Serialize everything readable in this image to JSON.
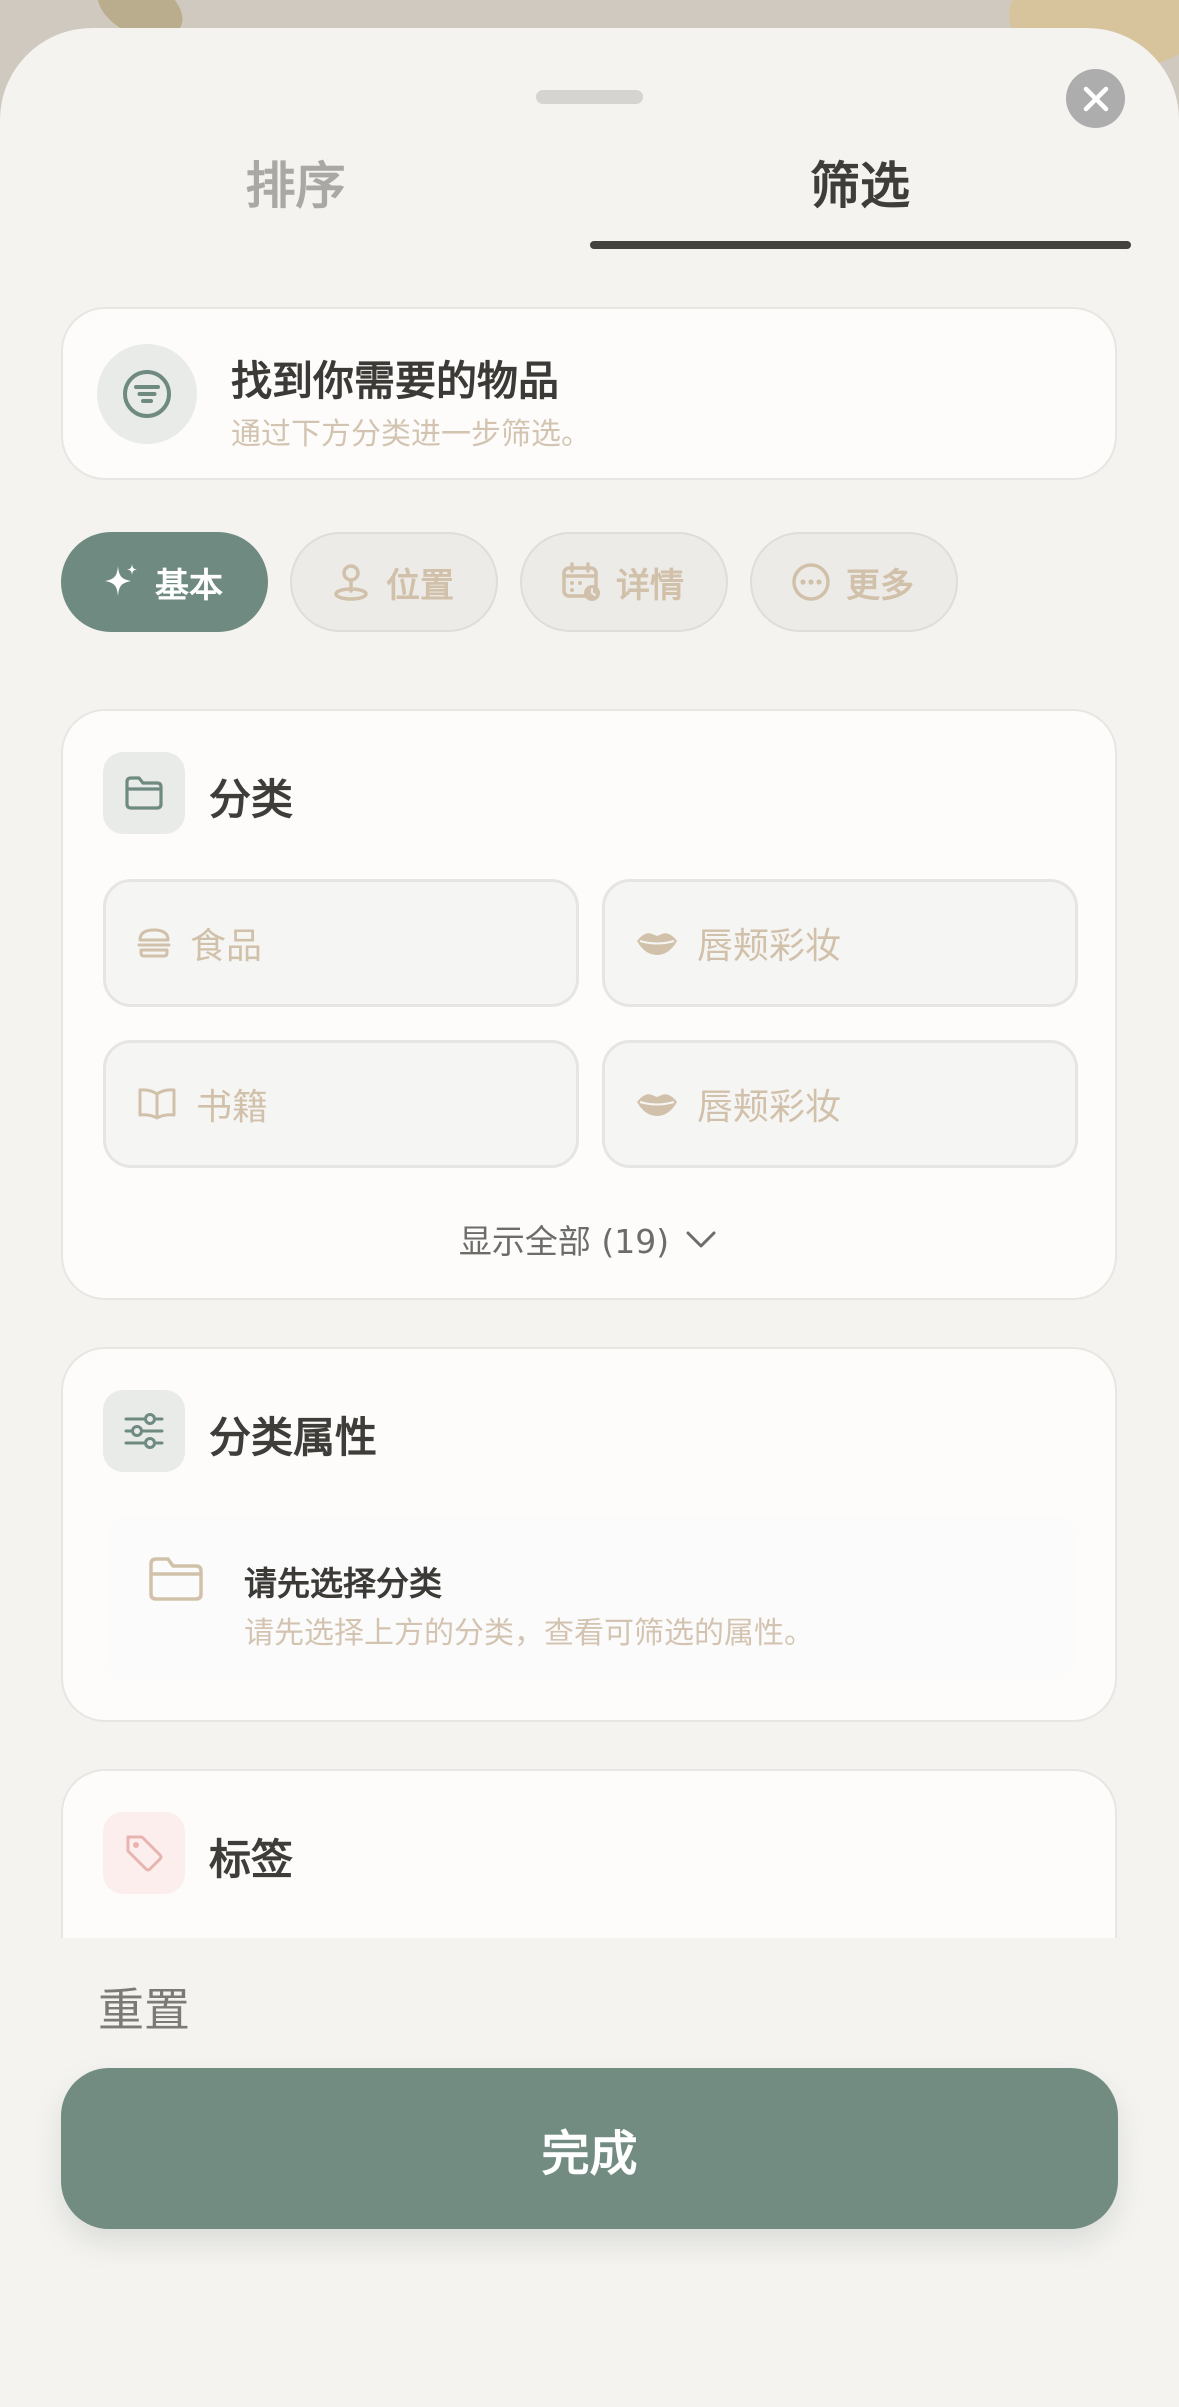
{
  "tabs": {
    "sort": "排序",
    "filter": "筛选"
  },
  "hero": {
    "title": "找到你需要的物品",
    "subtitle": "通过下方分类进一步筛选。"
  },
  "chips": [
    {
      "label": "基本",
      "icon": "sparkle-icon",
      "active": true
    },
    {
      "label": "位置",
      "icon": "map-pin-icon",
      "active": false
    },
    {
      "label": "详情",
      "icon": "calendar-icon",
      "active": false
    },
    {
      "label": "更多",
      "icon": "more-icon",
      "active": false
    }
  ],
  "category": {
    "title": "分类",
    "items": [
      {
        "label": "食品",
        "icon": "burger-icon"
      },
      {
        "label": "唇颊彩妆",
        "icon": "lips-icon"
      },
      {
        "label": "书籍",
        "icon": "book-icon"
      },
      {
        "label": "唇颊彩妆",
        "icon": "lips-icon"
      }
    ],
    "show_all": "显示全部 (19)"
  },
  "attributes": {
    "title": "分类属性",
    "empty_title": "请先选择分类",
    "empty_subtitle": "请先选择上方的分类，查看可筛选的属性。"
  },
  "tags": {
    "title": "标签"
  },
  "footer": {
    "reset": "重置",
    "done": "完成"
  },
  "colors": {
    "accent": "#728c82",
    "active_chip": "#6f8a80",
    "muted_text": "#d3c4b1",
    "sheet_bg": "#f4f3f0",
    "tag_icon_bg": "#fbeeed"
  }
}
